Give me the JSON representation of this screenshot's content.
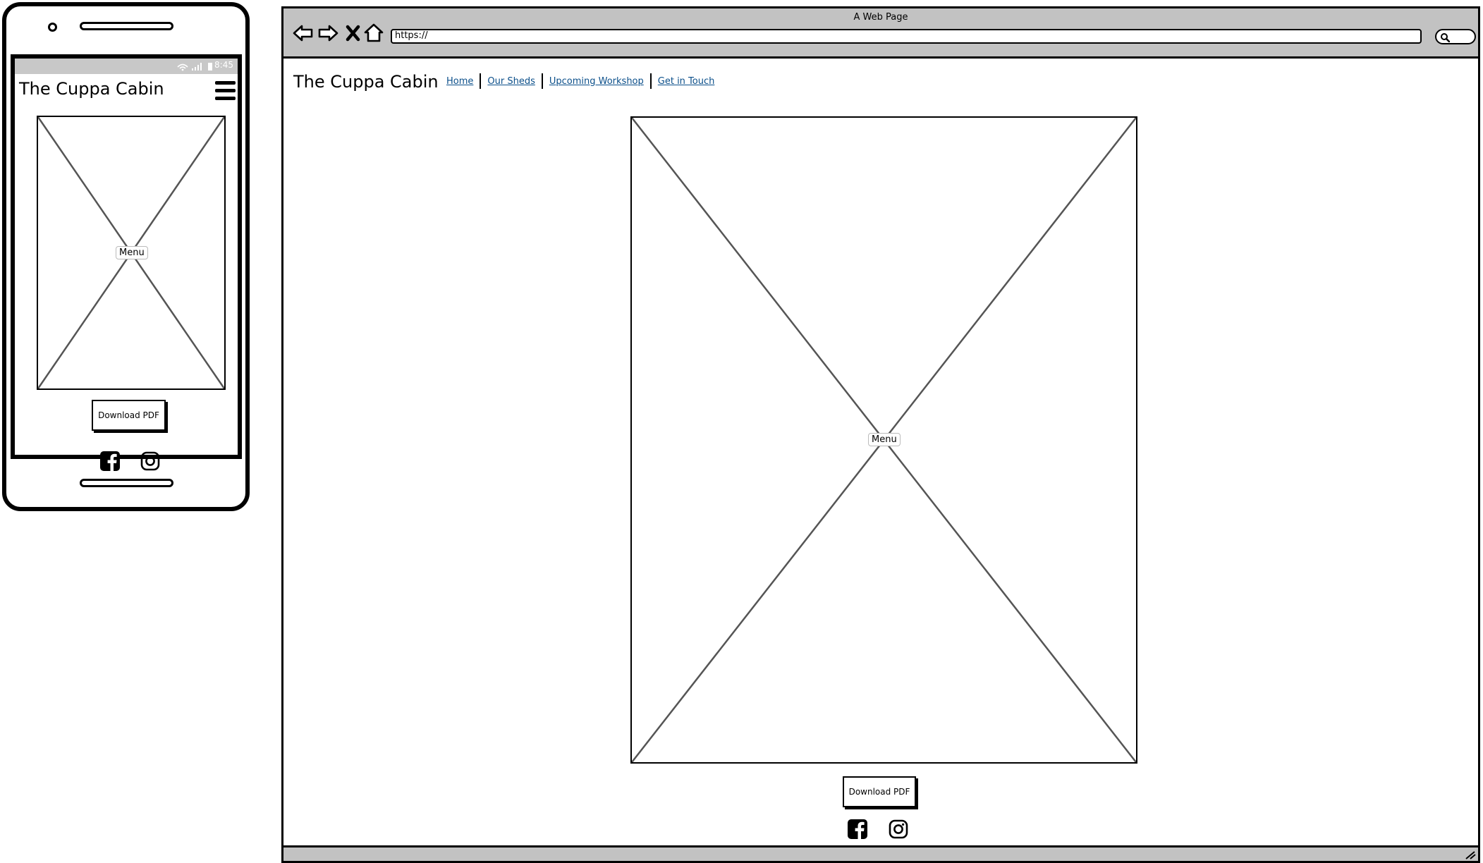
{
  "mobile": {
    "status_time": "8:45",
    "site_title": "The Cuppa Cabin",
    "image_placeholder_label": "Menu",
    "download_label": "Download PDF",
    "social_icons": [
      "facebook-icon",
      "instagram-icon"
    ]
  },
  "desktop": {
    "window_title": "A Web Page",
    "address": "https://",
    "site_title": "The Cuppa Cabin",
    "nav_links": [
      "Home",
      "Our Sheds",
      "Upcoming Workshop",
      "Get in Touch"
    ],
    "image_placeholder_label": "Menu",
    "download_label": "Download PDF",
    "social_icons": [
      "facebook-icon",
      "instagram-icon"
    ]
  },
  "colors": {
    "chrome_gray": "#c2c2c2",
    "link_blue": "#0b4f8a",
    "status_bar": "#c8c8c8"
  }
}
